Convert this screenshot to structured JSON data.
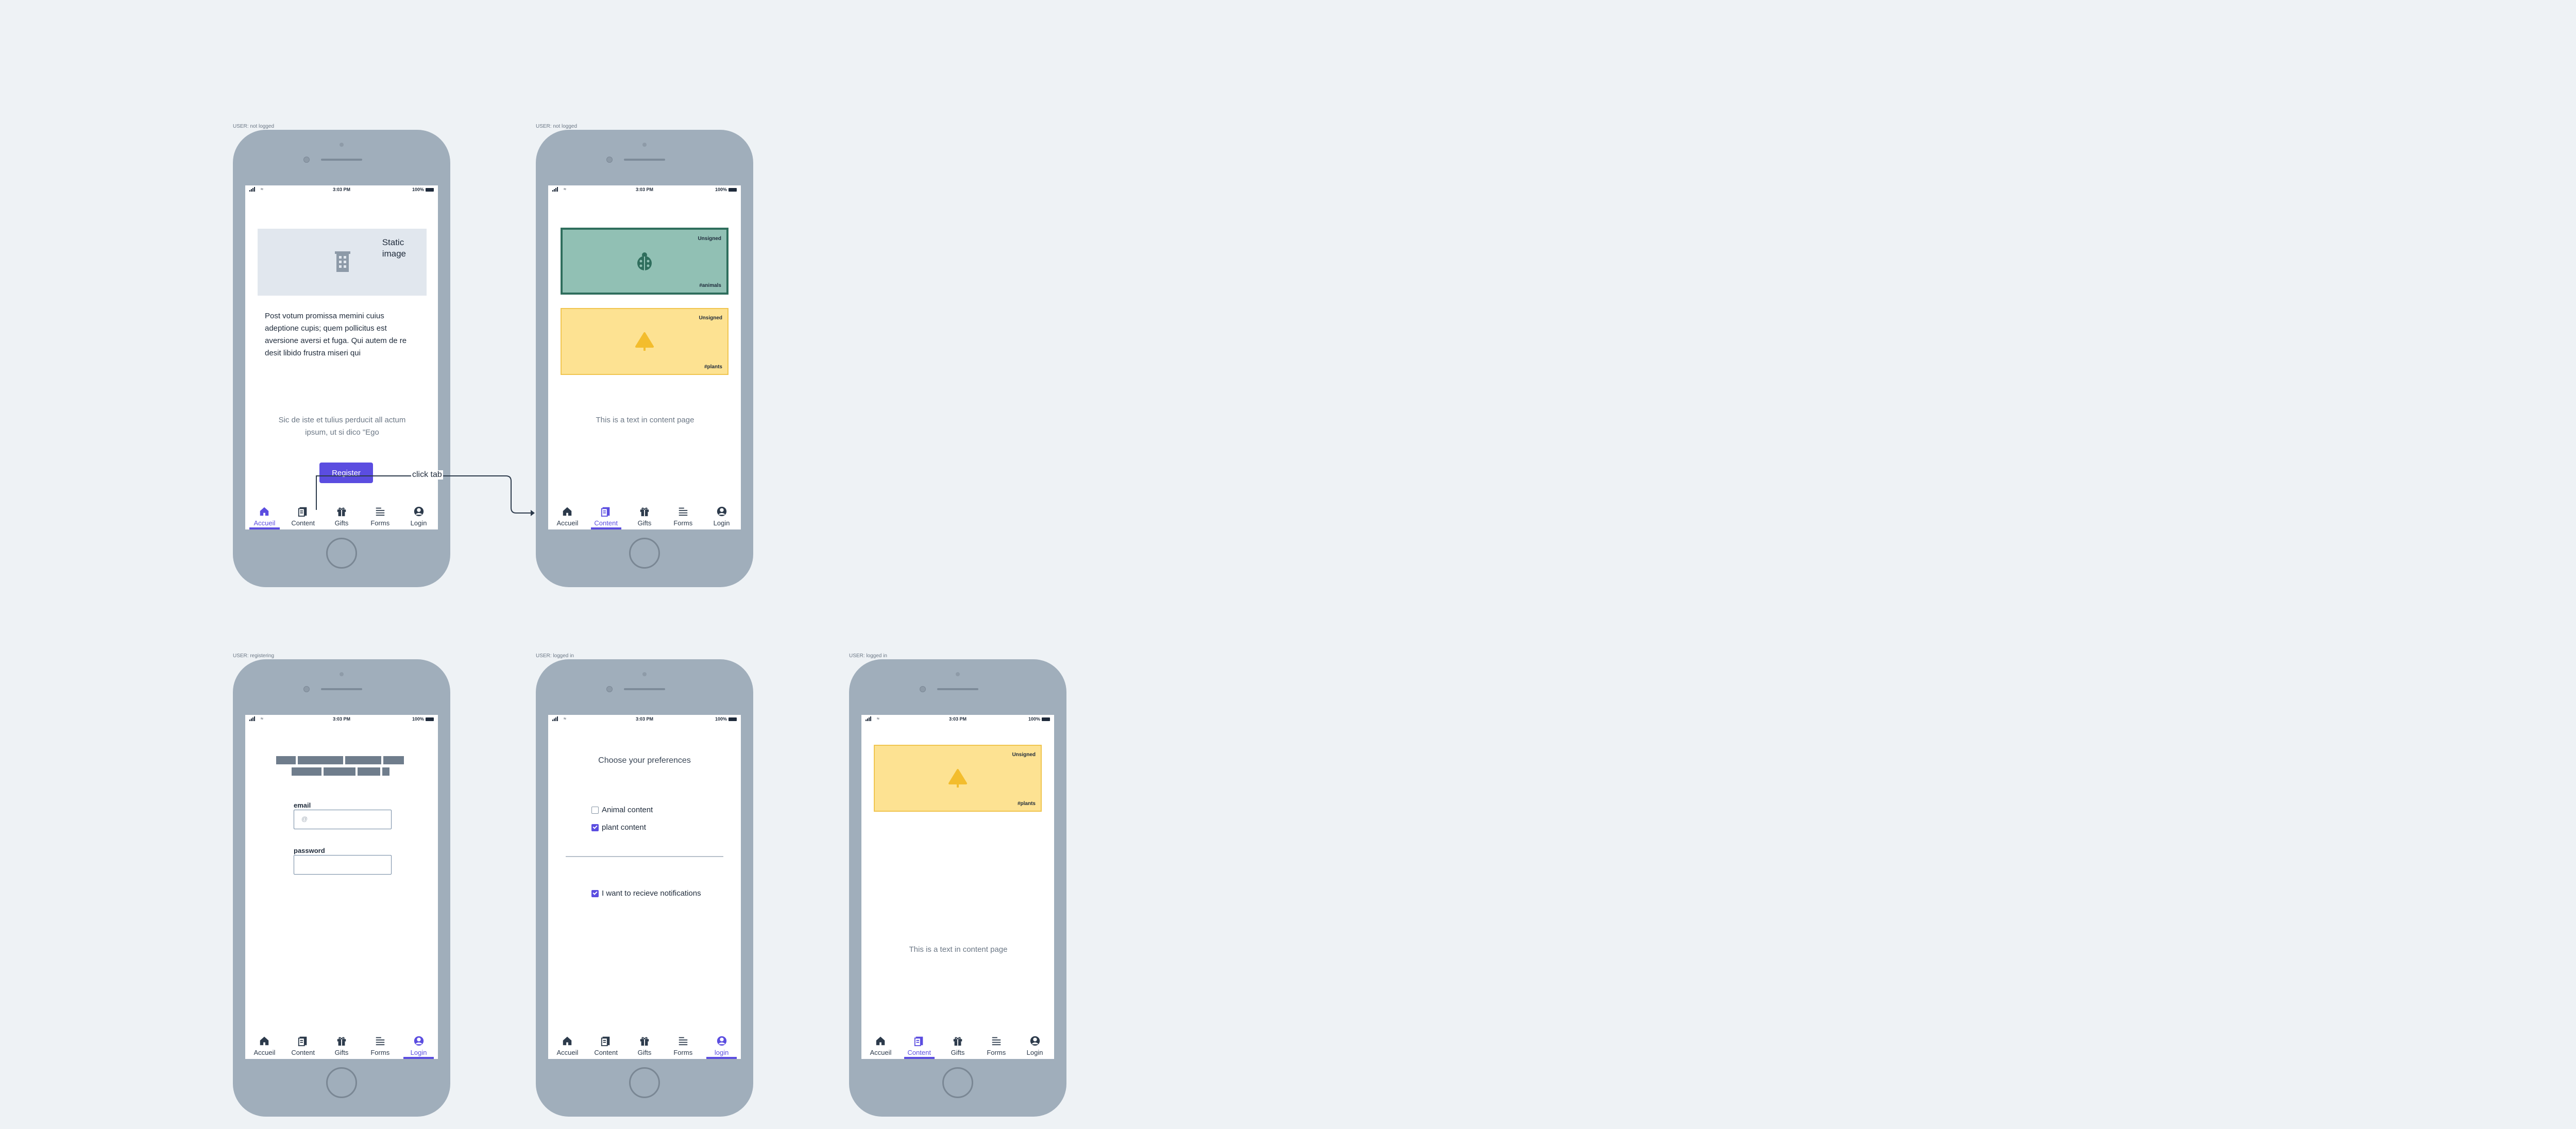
{
  "frames": {
    "f1": {
      "label": "USER: not logged"
    },
    "f2": {
      "label": "USER: not logged"
    },
    "f3": {
      "label": "USER: registering"
    },
    "f4": {
      "label": "USER: logged in"
    },
    "f5": {
      "label": "USER: logged in"
    }
  },
  "status_bar": {
    "time": "3:03 PM",
    "battery": "100%"
  },
  "tabs": [
    "Accueil",
    "Content",
    "Gifts",
    "Forms",
    "Login"
  ],
  "tabs_logged": [
    "Accueil",
    "Content",
    "Gifts",
    "Forms",
    "login"
  ],
  "home": {
    "image_label_line1": "Static",
    "image_label_line2": "image",
    "paragraph": "Post votum promissa memini cuius adeptione cupis; quem pollicitus est aversione aversi et fuga. Qui autem de re desit libido frustra miseri qui",
    "centered_text": "Sic de iste et tulius perducit all actum ipsum, ut si dico \"Ego",
    "register_label": "Register"
  },
  "flow": {
    "arrow_label": "click tab"
  },
  "content": {
    "card_tag_top": "Unsigned",
    "card_green_bottom": "#animals",
    "card_yellow_bottom": "#plants",
    "text": "This is a text in content page"
  },
  "register": {
    "email_label": "email",
    "email_placeholder": "@",
    "password_label": "password"
  },
  "prefs": {
    "title": "Choose your preferences",
    "animal": "Animal content",
    "plant": "plant content",
    "notifications": "I want to recieve notifications"
  },
  "colors": {
    "accent": "#5b4de0",
    "phone": "#a0aebb",
    "green_card": "#91c0b4",
    "yellow_card": "#fde292"
  },
  "icons": [
    "home-icon",
    "content-icon",
    "gift-icon",
    "forms-icon",
    "user-icon",
    "building-icon",
    "ladybug-icon",
    "tree-icon"
  ]
}
